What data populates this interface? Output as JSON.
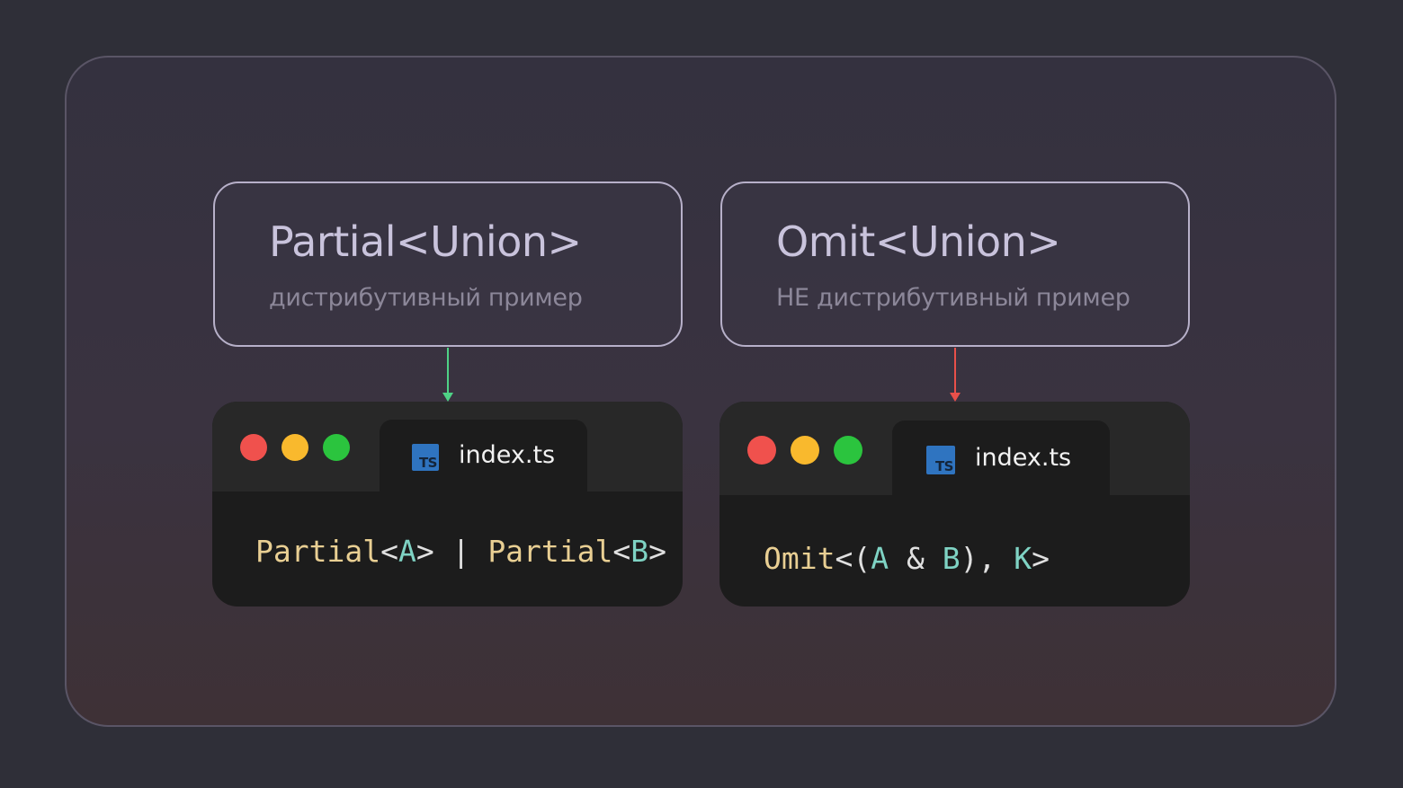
{
  "colors": {
    "page_background": "#2f2f38",
    "card_border": "#b7b0c9",
    "title_text": "#c9c3dc",
    "subtitle_text": "#8c8799",
    "arrow_left": "#4fd286",
    "arrow_right": "#e8504a",
    "dot_red": "#f0514d",
    "dot_yellow": "#f9b92d",
    "dot_green": "#2bc43e",
    "code_type": "#e9cf93",
    "code_param": "#7fd3c4",
    "code_punct": "#e0e0e0"
  },
  "left": {
    "title": "Partial<Union>",
    "subtitle": "дистрибутивный пример",
    "editor": {
      "icon": "typescript-file-icon",
      "icon_text": "TS",
      "tab_label": "index.ts",
      "code_tokens": [
        {
          "text": "Partial",
          "kind": "type"
        },
        {
          "text": "<",
          "kind": "punct"
        },
        {
          "text": "A",
          "kind": "param"
        },
        {
          "text": "> | ",
          "kind": "punct"
        },
        {
          "text": "Partial",
          "kind": "type"
        },
        {
          "text": "<",
          "kind": "punct"
        },
        {
          "text": "B",
          "kind": "param"
        },
        {
          "text": ">",
          "kind": "punct"
        }
      ]
    }
  },
  "right": {
    "title": "Omit<Union>",
    "subtitle": "НЕ дистрибутивный пример",
    "editor": {
      "icon": "typescript-file-icon",
      "icon_text": "TS",
      "tab_label": "index.ts",
      "code_tokens": [
        {
          "text": "Omit",
          "kind": "type"
        },
        {
          "text": "<(",
          "kind": "punct"
        },
        {
          "text": "A",
          "kind": "param"
        },
        {
          "text": " & ",
          "kind": "punct"
        },
        {
          "text": "B",
          "kind": "param"
        },
        {
          "text": "), ",
          "kind": "punct"
        },
        {
          "text": "K",
          "kind": "param"
        },
        {
          "text": ">",
          "kind": "punct"
        }
      ]
    }
  }
}
